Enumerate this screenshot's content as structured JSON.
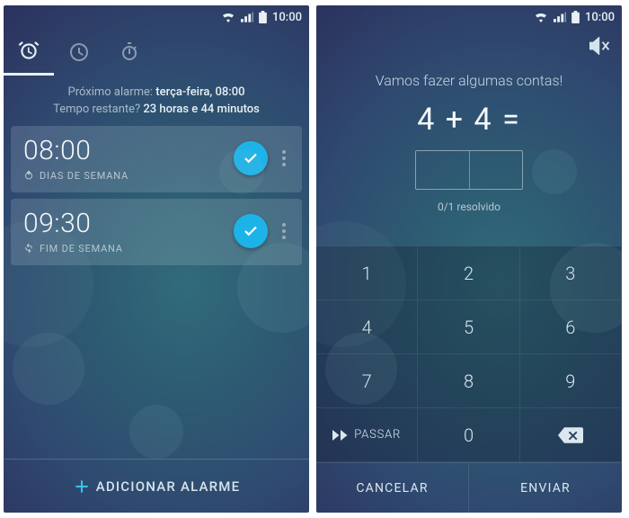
{
  "status": {
    "time": "10:00"
  },
  "screen1": {
    "summary": {
      "next_label": "Próximo alarme:",
      "next_value": "terça-feira, 08:00",
      "remain_label": "Tempo restante?",
      "remain_value": "23 horas e 44 minutos"
    },
    "alarms": [
      {
        "time": "08:00",
        "repeat": "DIAS DE SEMANA"
      },
      {
        "time": "09:30",
        "repeat": "FIM DE SEMANA"
      }
    ],
    "add_label": "ADICIONAR ALARME"
  },
  "screen2": {
    "title": "Vamos fazer algumas contas!",
    "equation": "4 + 4 =",
    "progress": "0/1 resolvido",
    "keys": [
      "1",
      "2",
      "3",
      "4",
      "5",
      "6",
      "7",
      "8",
      "9"
    ],
    "skip": "PASSAR",
    "zero": "0",
    "cancel": "CANCELAR",
    "send": "ENVIAR"
  }
}
